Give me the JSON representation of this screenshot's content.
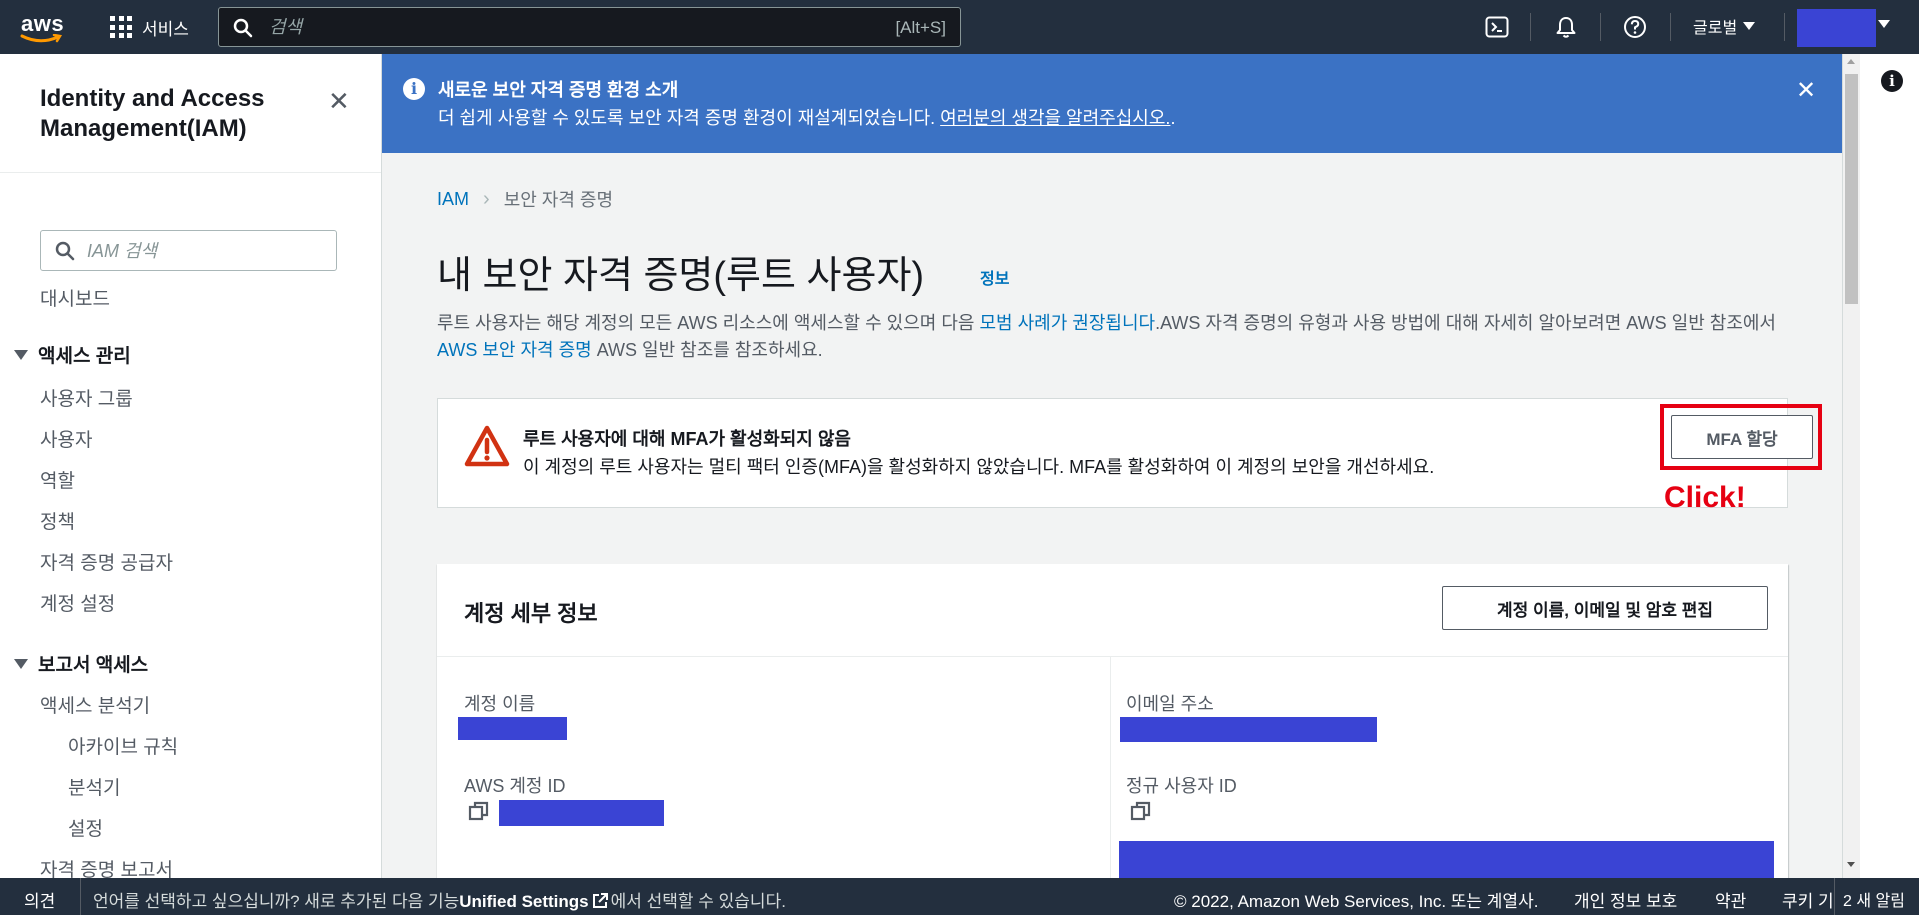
{
  "topnav": {
    "logo_text": "aws",
    "services_label": "서비스",
    "search_placeholder": "검색",
    "search_shortcut": "[Alt+S]",
    "region_label": "글로벌"
  },
  "sidebar": {
    "title": "Identity and Access Management(IAM)",
    "search_placeholder": "IAM 검색",
    "dashboard": "대시보드",
    "section_access": "액세스 관리",
    "access_items": [
      "사용자 그룹",
      "사용자",
      "역할",
      "정책",
      "자격 증명 공급자",
      "계정 설정"
    ],
    "section_reports": "보고서 액세스",
    "report_items": [
      "액세스 분석기"
    ],
    "report_subitems": [
      "아카이브 규칙",
      "분석기",
      "설정"
    ],
    "credential_report": "자격 증명 보고서"
  },
  "flash": {
    "title": "새로운 보안 자격 증명 환경 소개",
    "body": "더 쉽게 사용할 수 있도록 보안 자격 증명 환경이 재설계되었습니다. ",
    "link": "여러분의 생각을 알려주십시오.",
    "suffix": "."
  },
  "breadcrumb": [
    "IAM",
    "보안 자격 증명"
  ],
  "page": {
    "title": "내 보안 자격 증명(루트 사용자)",
    "info_link": "정보",
    "desc_1": "루트 사용자는 해당 계정의 모든 AWS 리소스에 액세스할 수 있으며 다음 ",
    "desc_link_1": "모범 사례가 권장됩니다",
    "desc_2": ".AWS 자격 증명의 유형과 사용 방법에 대해 자세히 알아보려면 AWS 일반 참조에서 ",
    "desc_link_2": "AWS 보안 자격 증명",
    "desc_3": " AWS 일반 참조를 참조하세요."
  },
  "alert": {
    "title": "루트 사용자에 대해 MFA가 활성화되지 않음",
    "body": "이 계정의 루트 사용자는 멀티 팩터 인증(MFA)을 활성화하지 않았습니다. MFA를 활성화하여 이 계정의 보안을 개선하세요.",
    "button": "MFA 할당",
    "annotation": "Click!"
  },
  "account_card": {
    "title": "계정 세부 정보",
    "edit_button": "계정 이름, 이메일 및 암호 편집",
    "account_name_label": "계정 이름",
    "email_label": "이메일 주소",
    "account_id_label": "AWS 계정 ID",
    "canonical_id_label": "정규 사용자 ID"
  },
  "footer": {
    "feedback": "의견",
    "lang_text": "언어를 선택하고 싶으십니까? 새로 추가된 다음 기능",
    "unified": "Unified Settings",
    "lang_text_2": "에서 선택할 수 있습니다.",
    "copyright": "© 2022, Amazon Web Services, Inc. 또는 계열사.",
    "privacy": "개인 정보 보호",
    "terms": "약관",
    "cookies": "쿠키 기",
    "notifications": "2 새 알림"
  },
  "colors": {
    "nav_bg": "#232f3e",
    "flash_bg": "#3b72c4",
    "link": "#0073bb",
    "redaction": "#3a44d4",
    "highlight": "#e60012"
  }
}
